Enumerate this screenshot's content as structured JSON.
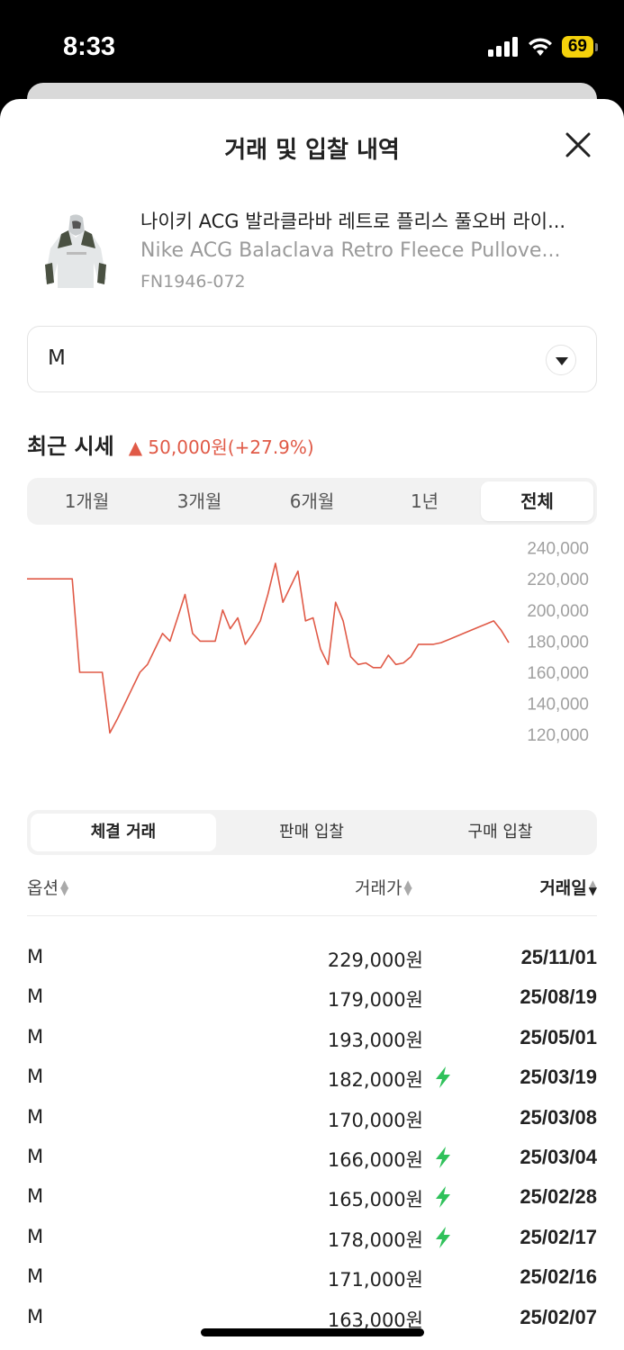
{
  "status_bar": {
    "time": "8:33",
    "battery": "69"
  },
  "sheet": {
    "title": "거래 및 입찰 내역"
  },
  "product": {
    "name_ko": "나이키 ACG 발라클라바 레트로 플리스 풀오버 라이...",
    "name_en": "Nike ACG Balaclava Retro Fleece Pullove...",
    "code": "FN1946-072"
  },
  "size_select": {
    "value": "M"
  },
  "recent": {
    "label": "최근 시세",
    "change": "▲ 50,000원(+27.9%)"
  },
  "period_tabs": [
    {
      "label": "1개월",
      "active": false
    },
    {
      "label": "3개월",
      "active": false
    },
    {
      "label": "6개월",
      "active": false
    },
    {
      "label": "1년",
      "active": false
    },
    {
      "label": "전체",
      "active": true
    }
  ],
  "chart_data": {
    "type": "line",
    "color": "#e05a47",
    "ylim": [
      112000,
      245000
    ],
    "yticks": [
      "240,000",
      "220,000",
      "200,000",
      "180,000",
      "160,000",
      "140,000",
      "120,000"
    ],
    "values": [
      220000,
      220000,
      220000,
      220000,
      220000,
      220000,
      220000,
      160000,
      160000,
      160000,
      160000,
      121000,
      130000,
      140000,
      150000,
      160000,
      165000,
      175000,
      185000,
      180000,
      195000,
      210000,
      185000,
      180000,
      180000,
      180000,
      200000,
      188000,
      195000,
      178000,
      185000,
      193000,
      210000,
      230000,
      205000,
      215000,
      225000,
      193000,
      195000,
      175000,
      165000,
      205000,
      193000,
      170000,
      165000,
      166000,
      163000,
      163000,
      171000,
      165000,
      166000,
      170000,
      178000,
      178000,
      178000,
      179000,
      181000,
      183000,
      185000,
      187000,
      189000,
      191000,
      193000,
      187000,
      179000
    ],
    "grid": false
  },
  "trade_tabs": [
    {
      "label": "체결 거래",
      "active": true
    },
    {
      "label": "판매 입찰",
      "active": false
    },
    {
      "label": "구매 입찰",
      "active": false
    }
  ],
  "table": {
    "headers": {
      "option": "옵션",
      "price": "거래가",
      "date": "거래일"
    },
    "rows": [
      {
        "option": "M",
        "price": "229,000원",
        "fast": false,
        "date": "25/11/01"
      },
      {
        "option": "M",
        "price": "179,000원",
        "fast": false,
        "date": "25/08/19"
      },
      {
        "option": "M",
        "price": "193,000원",
        "fast": false,
        "date": "25/05/01"
      },
      {
        "option": "M",
        "price": "182,000원",
        "fast": true,
        "date": "25/03/19"
      },
      {
        "option": "M",
        "price": "170,000원",
        "fast": false,
        "date": "25/03/08"
      },
      {
        "option": "M",
        "price": "166,000원",
        "fast": true,
        "date": "25/03/04"
      },
      {
        "option": "M",
        "price": "165,000원",
        "fast": true,
        "date": "25/02/28"
      },
      {
        "option": "M",
        "price": "178,000원",
        "fast": true,
        "date": "25/02/17"
      },
      {
        "option": "M",
        "price": "171,000원",
        "fast": false,
        "date": "25/02/16"
      },
      {
        "option": "M",
        "price": "163,000원",
        "fast": false,
        "date": "25/02/07"
      }
    ]
  },
  "colors": {
    "accent_red": "#e05a47",
    "bolt_green": "#2fc15a"
  }
}
